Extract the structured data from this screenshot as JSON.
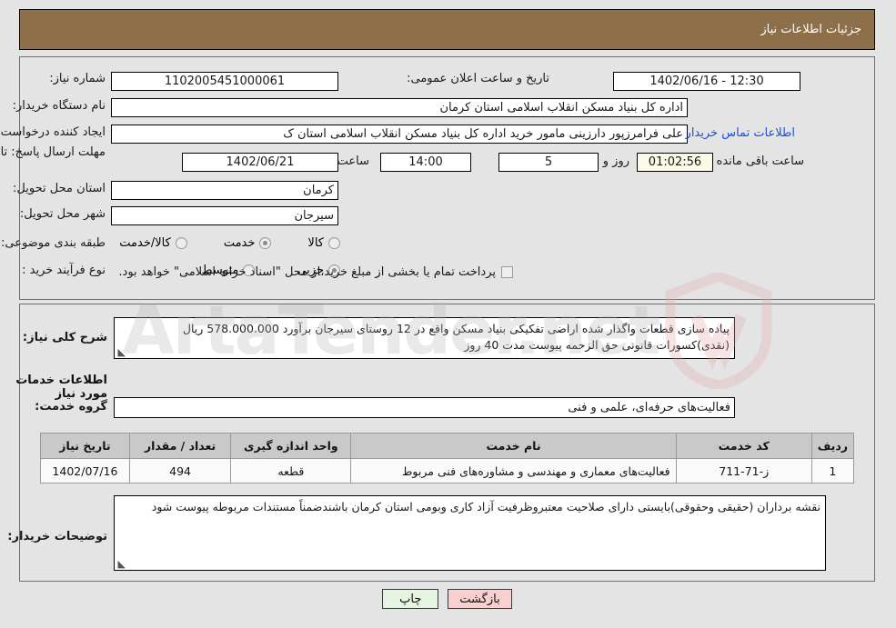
{
  "header": {
    "title": "جزئیات اطلاعات نیاز"
  },
  "form": {
    "need_number_label": "شماره نیاز:",
    "need_number_value": "1102005451000061",
    "announce_label": "تاریخ و ساعت اعلان عمومی:",
    "announce_value": "12:30 - 1402/06/16",
    "buyer_org_label": "نام دستگاه خریدار:",
    "buyer_org_value": "اداره کل بنیاد مسکن انقلاب اسلامی استان کرمان",
    "creator_label": "ایجاد کننده درخواست:",
    "creator_value": "علی فرامرزپور دارزینی مامور خرید اداره کل بنیاد مسکن انقلاب اسلامی استان ک",
    "contact_link": "اطلاعات تماس خریدار",
    "deadline_label": "مهلت ارسال پاسخ: تا تاریخ:",
    "deadline_date": "1402/06/21",
    "deadline_hour_label": "ساعت",
    "deadline_hour": "14:00",
    "remaining_days": "5",
    "remaining_days_label": "روز و",
    "remaining_timer": "01:02:56",
    "remaining_suffix": "ساعت باقی مانده",
    "province_label": "استان محل تحویل:",
    "province_value": "کرمان",
    "city_label": "شهر محل تحویل:",
    "city_value": "سیرجان",
    "category_label": "طبقه بندی موضوعی:",
    "category_options": [
      "کالا",
      "خدمت",
      "کالا/خدمت"
    ],
    "process_label": "نوع فرآیند خرید :",
    "process_options": [
      "جزیی",
      "متوسط"
    ],
    "treasury_note": "پرداخت تمام یا بخشی از مبلغ خرید،از محل \"اسناد خزانه اسلامی\" خواهد بود."
  },
  "description": {
    "label": "شرح کلی نیاز:",
    "value": "پیاده سازی قطعات واگذار شده اراضی تفکیکی بنیاد مسکن واقع در 12 روستای سیرجان برآورد 578.000.000 ریال (نقدی)کسورات قانونی حق الزحمه پیوست مدت  40 روز"
  },
  "services": {
    "section_title": "اطلاعات خدمات مورد نیاز",
    "group_label": "گروه خدمت:",
    "group_value": "فعالیت‌های حرفه‌ای، علمی و فنی",
    "columns": [
      "ردیف",
      "کد خدمت",
      "نام خدمت",
      "واحد اندازه گیری",
      "تعداد / مقدار",
      "تاریخ نیاز"
    ],
    "rows": [
      {
        "row_no": "1",
        "code": "ز-71-711",
        "name": "فعالیت‌های معماری و مهندسی و مشاوره‌های فنی مربوط",
        "unit": "قطعه",
        "quantity": "494",
        "need_date": "1402/07/16"
      }
    ]
  },
  "buyer_notes": {
    "label": "توضیحات خریدار:",
    "value": "نقشه برداران (حقیقی وحقوقی)بایستی دارای صلاحیت معتبروظرفیت آزاد کاری وبومی استان کرمان باشندضمناً مستندات مربوطه پیوست شود"
  },
  "footer": {
    "print_label": "چاپ",
    "back_label": "بازگشت"
  },
  "watermark": {
    "text": "ArtaTender.net"
  },
  "colors": {
    "header_bg": "#8d6f4a",
    "page_bg": "#e4e4e4",
    "link": "#1b4fd8",
    "timer_bg": "#fbfbe8",
    "table_header_bg": "#c9c9c9",
    "back_btn_bg": "#f9cfcf",
    "print_btn_bg": "#e6f4e2"
  }
}
